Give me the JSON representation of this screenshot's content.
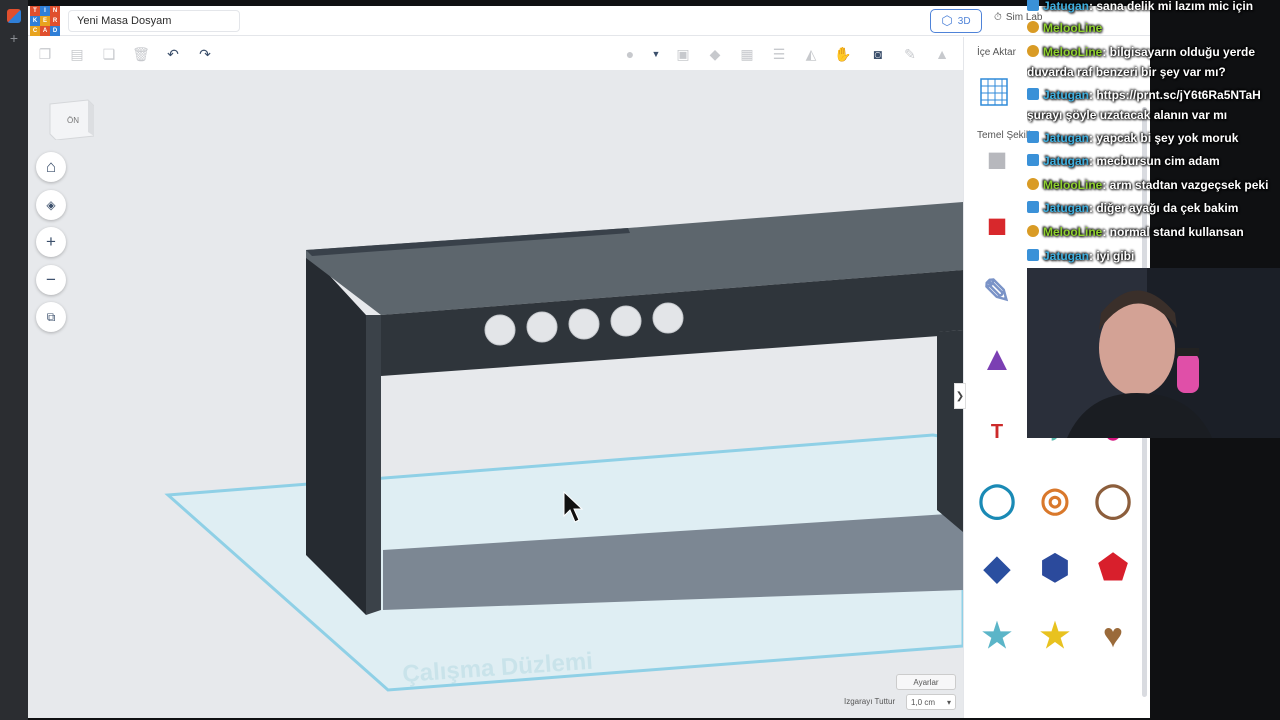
{
  "app": {
    "logo_letters": [
      "T",
      "I",
      "N",
      "K",
      "E",
      "R",
      "C",
      "A",
      "D"
    ],
    "document_title": "Yeni Masa Dosyam",
    "view_mode_label": "3D",
    "simlab_label": "Sim Lab"
  },
  "viewcube": {
    "face_label": "ÖN"
  },
  "nav_controls": [
    {
      "name": "home-view-button",
      "icon": "home-icon"
    },
    {
      "name": "fit-view-button",
      "icon": "fit-icon"
    },
    {
      "name": "zoom-in-button",
      "icon": "plus-icon"
    },
    {
      "name": "zoom-out-button",
      "icon": "minus-icon"
    },
    {
      "name": "ortho-view-button",
      "icon": "cube-icon"
    }
  ],
  "workplane": {
    "watermark": "Çalışma Düzlemi"
  },
  "right_panel": {
    "import_label": "İçe Aktar",
    "shapes_label": "Temel Şekiller",
    "shapes": [
      {
        "name": "box-hole",
        "color": "#b7b8bd"
      },
      {
        "name": "box",
        "color": "#d8282c"
      },
      {
        "name": "scribble",
        "color": "#7a93c7"
      },
      {
        "name": "cone",
        "color": "#7b3fb3"
      },
      {
        "name": "text",
        "color": "#cc2a2a"
      },
      {
        "name": "half-cylinder",
        "color": "#5ab8ad"
      },
      {
        "name": "paraboloid",
        "color": "#d4167f"
      },
      {
        "name": "torus",
        "color": "#1a8ab5"
      },
      {
        "name": "tube",
        "color": "#d9782b"
      },
      {
        "name": "ring",
        "color": "#8c5e3c"
      },
      {
        "name": "wedge-box",
        "color": "#2a4fa0"
      },
      {
        "name": "hexagon-prism",
        "color": "#2b4a9c"
      },
      {
        "name": "polyhedron",
        "color": "#d81f2c"
      },
      {
        "name": "star-flat",
        "color": "#5bb5c8"
      },
      {
        "name": "star",
        "color": "#e8c21f"
      },
      {
        "name": "heart",
        "color": "#9a6a3a"
      }
    ],
    "settings_label": "Ayarlar",
    "snap_label": "Izgarayı Tuttur",
    "snap_value": "1,0 cm"
  },
  "chat": [
    {
      "user": "Jatugan",
      "platform": "twitch",
      "text": ": sana delik mi lazım mic için"
    },
    {
      "user": "MelooLine",
      "platform": "youtube",
      "text": ""
    },
    {
      "user": "MelooLine",
      "platform": "youtube",
      "text": ": bilgisayarın olduğu yerde"
    },
    {
      "user": "",
      "platform": "",
      "text": "duvarda raf benzeri bir şey var mı?"
    },
    {
      "user": "Jatugan",
      "platform": "twitch",
      "text": ": https://prnt.sc/jY6t6Ra5NTaH"
    },
    {
      "user": "",
      "platform": "",
      "text": "şurayı şöyle uzatacak alanın var mı"
    },
    {
      "user": "Jatugan",
      "platform": "twitch",
      "text": ": yapcak bi şey yok moruk"
    },
    {
      "user": "Jatugan",
      "platform": "twitch",
      "text": ": mecbursun cim adam"
    },
    {
      "user": "MelooLine",
      "platform": "youtube",
      "text": ": arm stadtan vazgeçsek peki"
    },
    {
      "user": "Jatugan",
      "platform": "twitch",
      "text": ": diğer ayağı da çek bakim"
    },
    {
      "user": "MelooLine",
      "platform": "youtube",
      "text": ": normal stand kullansan"
    },
    {
      "user": "Jatugan",
      "platform": "twitch",
      "text": ": iyi gibi"
    }
  ]
}
